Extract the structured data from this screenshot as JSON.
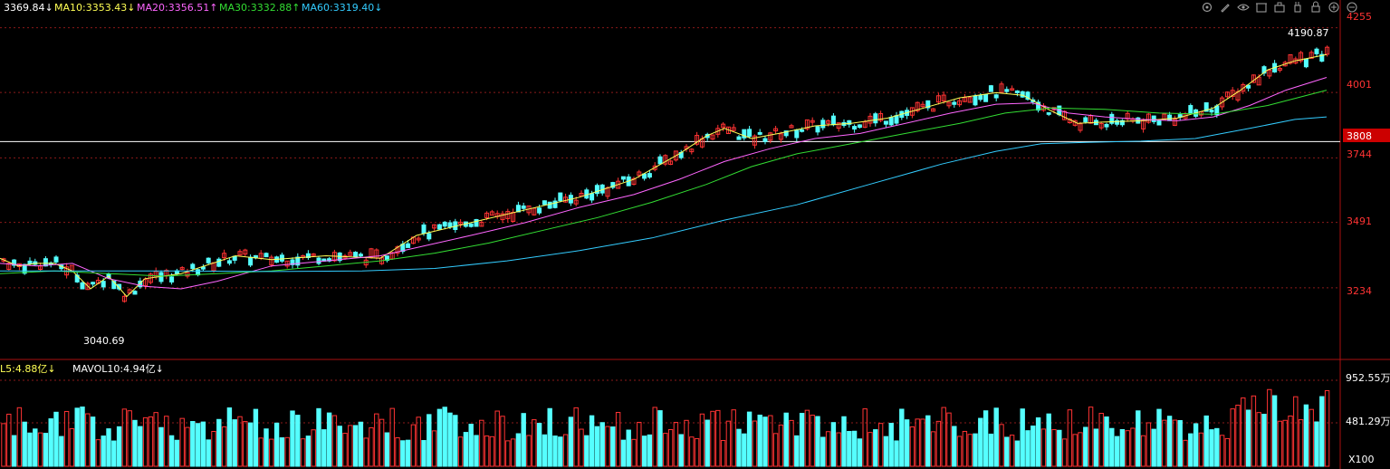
{
  "header": {
    "close": {
      "value": "3369.84",
      "arrow": "↓",
      "color": "#ffffff"
    },
    "ma": [
      {
        "label": "MA10:",
        "value": "3353.43",
        "arrow": "↓",
        "color": "#ffff55"
      },
      {
        "label": "MA20:",
        "value": "3356.51",
        "arrow": "↑",
        "color": "#ff66ff"
      },
      {
        "label": "MA30:",
        "value": "3332.88",
        "arrow": "↑",
        "color": "#33dd33"
      },
      {
        "label": "MA60:",
        "value": "3319.40",
        "arrow": "↓",
        "color": "#33ccff"
      }
    ]
  },
  "volume_header": {
    "items": [
      {
        "label": "L5:",
        "value": "4.88亿",
        "arrow": "↓",
        "color": "#ffff55"
      },
      {
        "label": "MAVOL10:",
        "value": "4.94亿",
        "arrow": "↓",
        "color": "#ffffff"
      }
    ]
  },
  "toolbar_icons": [
    "settings-icon",
    "pen-icon",
    "eye-icon",
    "building-icon",
    "briefcase-icon",
    "hand-icon",
    "lock-icon",
    "zoom-in-icon",
    "zoom-out-icon"
  ],
  "price_axis": {
    "ticks": [
      "4255",
      "4001",
      "3744",
      "3491",
      "3234"
    ],
    "current_price_label": "3808",
    "current_price_value": 3808
  },
  "volume_axis": {
    "ticks": [
      "952.55万",
      "481.29万"
    ],
    "multiplier_label": "X100"
  },
  "annotations": {
    "high": "4190.87",
    "low": "3040.69"
  },
  "colors": {
    "up": "#ff3333",
    "down": "#55ffff",
    "grid": "#8b1a1a",
    "axis_text": "#ff3333",
    "background": "#000000"
  },
  "chart_data": {
    "type": "candlestick",
    "price_range": [
      2960,
      4300
    ],
    "volume_range": [
      0,
      952.55
    ],
    "ma_series": [
      {
        "name": "MA10",
        "color": "#ffff55",
        "points": [
          [
            0,
            3350
          ],
          [
            20,
            3320
          ],
          [
            40,
            3330
          ],
          [
            60,
            3330
          ],
          [
            80,
            3300
          ],
          [
            100,
            3230
          ],
          [
            120,
            3280
          ],
          [
            140,
            3200
          ],
          [
            160,
            3270
          ],
          [
            200,
            3290
          ],
          [
            260,
            3360
          ],
          [
            300,
            3345
          ],
          [
            360,
            3360
          ],
          [
            420,
            3350
          ],
          [
            460,
            3440
          ],
          [
            520,
            3490
          ],
          [
            580,
            3540
          ],
          [
            640,
            3590
          ],
          [
            700,
            3660
          ],
          [
            750,
            3760
          ],
          [
            780,
            3830
          ],
          [
            800,
            3860
          ],
          [
            830,
            3820
          ],
          [
            860,
            3840
          ],
          [
            900,
            3870
          ],
          [
            940,
            3880
          ],
          [
            980,
            3900
          ],
          [
            1020,
            3940
          ],
          [
            1060,
            3980
          ],
          [
            1100,
            4000
          ],
          [
            1130,
            3990
          ],
          [
            1160,
            3930
          ],
          [
            1190,
            3880
          ],
          [
            1220,
            3885
          ],
          [
            1260,
            3890
          ],
          [
            1300,
            3900
          ],
          [
            1340,
            3940
          ],
          [
            1370,
            4010
          ],
          [
            1400,
            4090
          ],
          [
            1430,
            4125
          ],
          [
            1465,
            4150
          ]
        ]
      },
      {
        "name": "MA20",
        "color": "#ff66ff",
        "points": [
          [
            0,
            3330
          ],
          [
            40,
            3320
          ],
          [
            80,
            3330
          ],
          [
            120,
            3270
          ],
          [
            160,
            3240
          ],
          [
            200,
            3230
          ],
          [
            240,
            3260
          ],
          [
            300,
            3320
          ],
          [
            360,
            3340
          ],
          [
            420,
            3360
          ],
          [
            470,
            3400
          ],
          [
            520,
            3440
          ],
          [
            580,
            3490
          ],
          [
            640,
            3550
          ],
          [
            700,
            3600
          ],
          [
            750,
            3660
          ],
          [
            800,
            3730
          ],
          [
            850,
            3780
          ],
          [
            900,
            3820
          ],
          [
            950,
            3840
          ],
          [
            1000,
            3880
          ],
          [
            1050,
            3920
          ],
          [
            1100,
            3955
          ],
          [
            1140,
            3960
          ],
          [
            1180,
            3920
          ],
          [
            1220,
            3905
          ],
          [
            1260,
            3895
          ],
          [
            1300,
            3890
          ],
          [
            1340,
            3905
          ],
          [
            1380,
            3950
          ],
          [
            1420,
            4010
          ],
          [
            1465,
            4060
          ]
        ]
      },
      {
        "name": "MA30",
        "color": "#33dd33",
        "points": [
          [
            0,
            3290
          ],
          [
            60,
            3300
          ],
          [
            120,
            3290
          ],
          [
            180,
            3280
          ],
          [
            240,
            3290
          ],
          [
            300,
            3300
          ],
          [
            360,
            3320
          ],
          [
            420,
            3340
          ],
          [
            480,
            3370
          ],
          [
            540,
            3410
          ],
          [
            600,
            3460
          ],
          [
            660,
            3510
          ],
          [
            720,
            3570
          ],
          [
            780,
            3640
          ],
          [
            830,
            3710
          ],
          [
            880,
            3760
          ],
          [
            940,
            3800
          ],
          [
            1000,
            3840
          ],
          [
            1060,
            3880
          ],
          [
            1110,
            3920
          ],
          [
            1160,
            3940
          ],
          [
            1220,
            3935
          ],
          [
            1280,
            3920
          ],
          [
            1340,
            3915
          ],
          [
            1400,
            3950
          ],
          [
            1465,
            4010
          ]
        ]
      },
      {
        "name": "MA60",
        "color": "#33ccff",
        "points": [
          [
            0,
            3300
          ],
          [
            100,
            3300
          ],
          [
            200,
            3300
          ],
          [
            300,
            3298
          ],
          [
            400,
            3300
          ],
          [
            480,
            3310
          ],
          [
            560,
            3340
          ],
          [
            640,
            3380
          ],
          [
            720,
            3430
          ],
          [
            800,
            3500
          ],
          [
            880,
            3560
          ],
          [
            960,
            3640
          ],
          [
            1040,
            3720
          ],
          [
            1100,
            3770
          ],
          [
            1150,
            3800
          ],
          [
            1200,
            3805
          ],
          [
            1260,
            3810
          ],
          [
            1320,
            3820
          ],
          [
            1380,
            3860
          ],
          [
            1430,
            3895
          ],
          [
            1465,
            3905
          ]
        ]
      }
    ]
  }
}
